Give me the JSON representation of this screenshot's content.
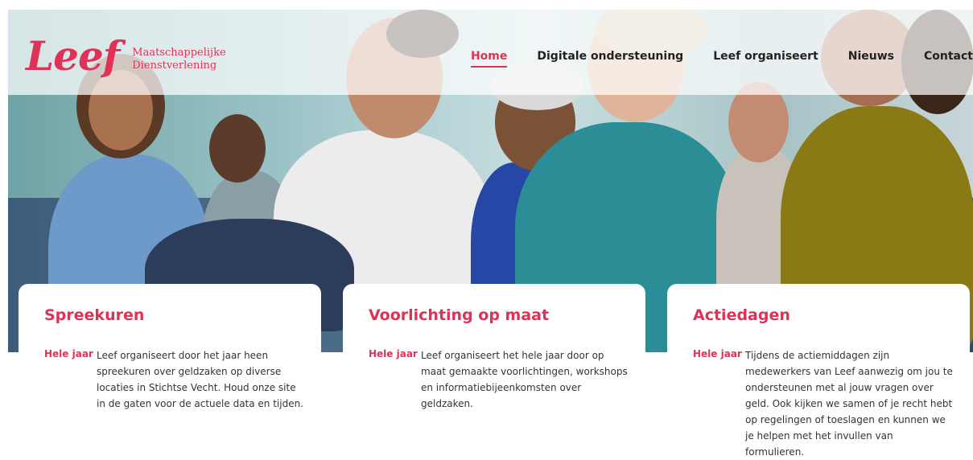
{
  "brand": {
    "name": "Leef",
    "subtitle_line1": "Maatschappelijke",
    "subtitle_line2": "Dienstverlening",
    "accent_color": "#e03157"
  },
  "nav": {
    "items": [
      {
        "label": "Home",
        "active": true
      },
      {
        "label": "Digitale ondersteuning",
        "active": false
      },
      {
        "label": "Leef organiseert",
        "active": false
      },
      {
        "label": "Nieuws",
        "active": false
      },
      {
        "label": "Contact",
        "active": false
      }
    ]
  },
  "cards": [
    {
      "title": "Spreekuren",
      "tag": "Hele jaar",
      "text": "Leef organiseert door het jaar heen spreekuren over geldzaken op diverse locaties in Stichtse Vecht. Houd onze site in de gaten voor de actuele data en tijden."
    },
    {
      "title": "Voorlichting op maat",
      "tag": "Hele jaar",
      "text": "Leef organiseert het hele jaar door op maat gemaakte voorlichtingen, workshops en informatiebijeenkomsten over geldzaken."
    },
    {
      "title": "Actiedagen",
      "tag": "Hele jaar",
      "text": "Tijdens de actiemiddagen zijn medewerkers van Leef aanwezig om jou te ondersteunen met al jouw vragen over geld. Ook kijken we samen of je recht hebt op regelingen of toeslagen en kunnen we je helpen met het invullen van formulieren."
    }
  ]
}
